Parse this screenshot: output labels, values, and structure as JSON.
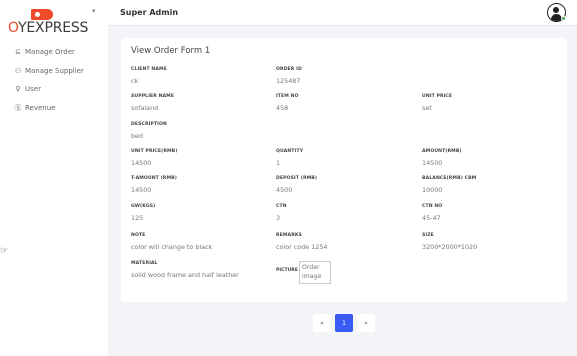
{
  "brand": {
    "logo_text_pre": "",
    "logo_o": "O",
    "logo_text_post": "YEXPRESS"
  },
  "header": {
    "title": "Super Admin"
  },
  "sidebar": {
    "items": [
      {
        "icon": "cart-icon",
        "glyph": "⊆",
        "label": "Manage Order"
      },
      {
        "icon": "users-icon",
        "glyph": "⚇",
        "label": "Manage Supplier"
      },
      {
        "icon": "user-icon",
        "glyph": "♀",
        "label": "User"
      },
      {
        "icon": "dollar-icon",
        "glyph": "Ⓢ",
        "label": "Revenue"
      }
    ]
  },
  "form": {
    "title": "View Order Form 1",
    "fields": {
      "client_name": {
        "label": "CLIENT NAME",
        "value": "ck"
      },
      "order_id": {
        "label": "ORDER ID",
        "value": "125487"
      },
      "supplier_name": {
        "label": "SUPPLIER NAME",
        "value": "sofaland"
      },
      "item_no": {
        "label": "ITEM NO",
        "value": "458"
      },
      "unit_price": {
        "label": "UNIT PRICE",
        "value": "set"
      },
      "description": {
        "label": "DESCRIPTION",
        "value": "bed"
      },
      "unit_price_rmb": {
        "label": "UNIT PRICE(RMB)",
        "value": "14500"
      },
      "quantity": {
        "label": "QUANTITY",
        "value": "1"
      },
      "amount_rmb": {
        "label": "AMOUNT(RMB)",
        "value": "14500"
      },
      "t_amount_rmb": {
        "label": "T-AMOUNT (RMB)",
        "value": "14500"
      },
      "deposit_rmb": {
        "label": "DEPOSIT (RMB)",
        "value": "4500"
      },
      "balance_rmb_cbm": {
        "label": "BALANCE(RMB) CBM",
        "value": "10000"
      },
      "gw_kgs": {
        "label": "GW(KGS)",
        "value": "125"
      },
      "ctn": {
        "label": "CTN",
        "value": "3"
      },
      "ctn_no": {
        "label": "CTN NO",
        "value": "45-47"
      },
      "note": {
        "label": "NOTE",
        "value": "color will change to black"
      },
      "remarks": {
        "label": "REMARKS",
        "value": "color code 1254"
      },
      "size": {
        "label": "SIZE",
        "value": "3200*2000*1020"
      },
      "material": {
        "label": "MATERIAL",
        "value": "solid wood frame and half leather"
      }
    },
    "picture": {
      "label": "PICTURE",
      "alt": "Order image"
    }
  },
  "pagination": {
    "prev": "«",
    "current": "1",
    "next": "»"
  }
}
